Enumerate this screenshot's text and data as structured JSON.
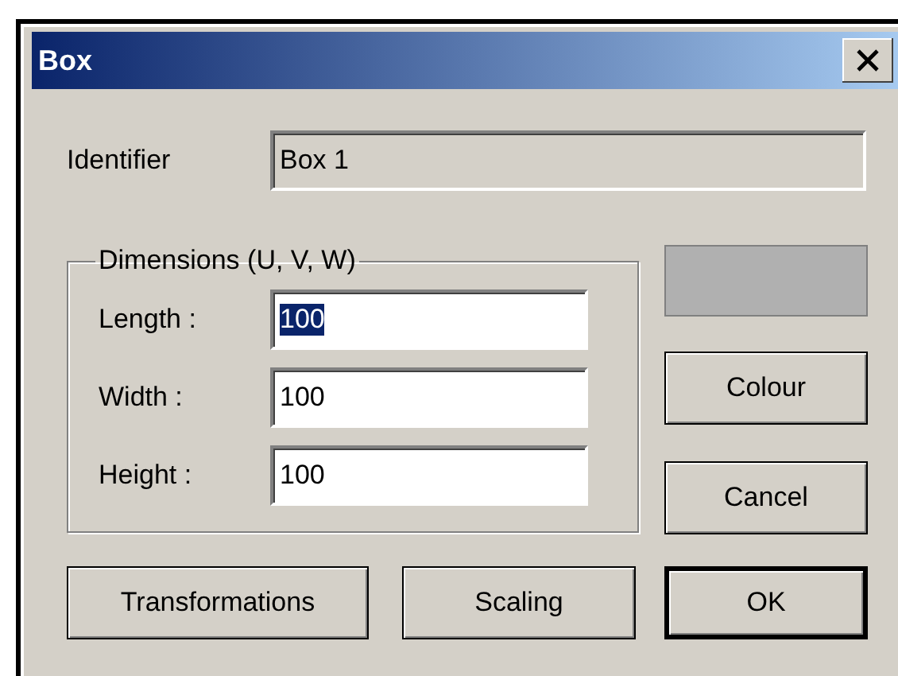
{
  "window": {
    "title": "Box"
  },
  "identifier": {
    "label": "Identifier",
    "value": "Box 1",
    "disabled": true
  },
  "dimensions": {
    "legend": "Dimensions (U, V, W)",
    "fields": [
      {
        "label": "Length :",
        "value": "100",
        "focused": true
      },
      {
        "label": "Width :",
        "value": "100",
        "focused": false
      },
      {
        "label": "Height :",
        "value": "100",
        "focused": false
      }
    ]
  },
  "swatch": {
    "color": "#b0b0b0"
  },
  "side_buttons": [
    {
      "label": "Colour",
      "default": false
    },
    {
      "label": "Cancel",
      "default": false
    }
  ],
  "bottom_buttons": [
    {
      "label": "Transformations",
      "default": false
    },
    {
      "label": "Scaling",
      "default": false
    },
    {
      "label": "OK",
      "default": true
    }
  ]
}
